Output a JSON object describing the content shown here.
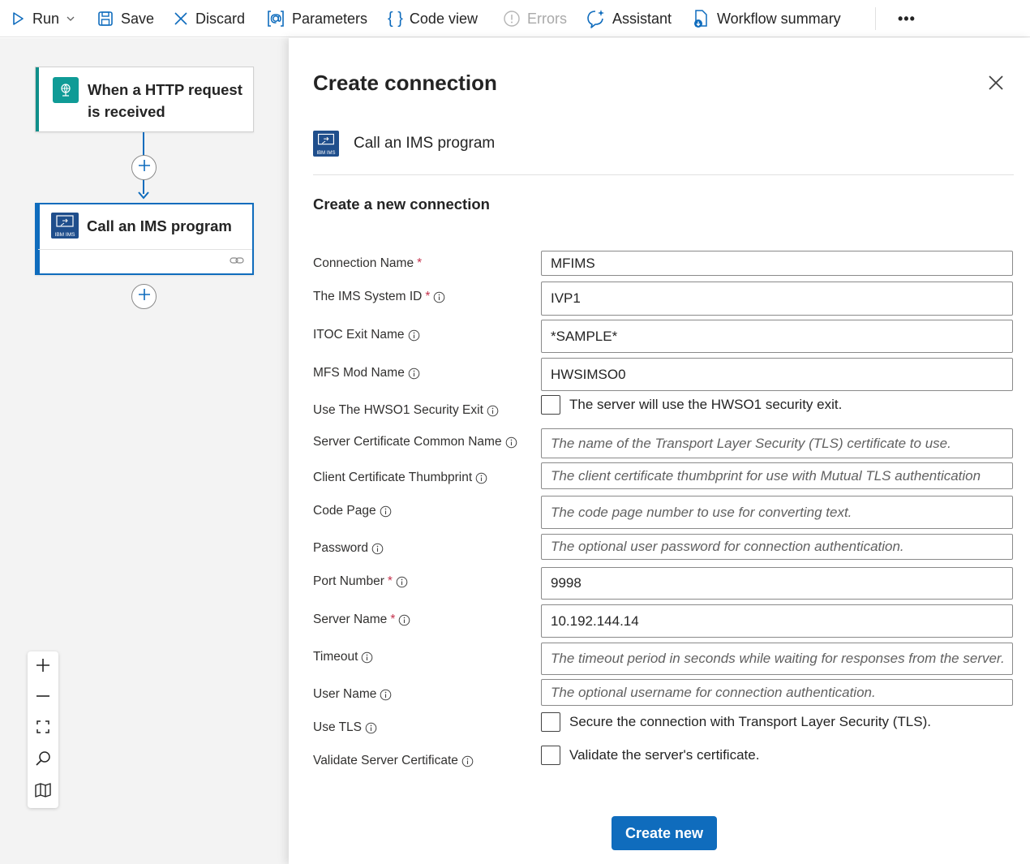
{
  "toolbar": {
    "run": "Run",
    "save": "Save",
    "discard": "Discard",
    "parameters": "Parameters",
    "code_view": "Code view",
    "errors": "Errors",
    "assistant": "Assistant",
    "workflow_summary": "Workflow summary",
    "more": "•••"
  },
  "canvas": {
    "trigger_title": "When a HTTP request is received",
    "action_title": "Call an IMS program",
    "action_icon_text": "IBM IMS"
  },
  "panel": {
    "title": "Create connection",
    "connector_name": "Call an IMS program",
    "connector_icon_text": "IBM IMS",
    "section_title": "Create a new connection",
    "fields": [
      {
        "label": "Connection Name",
        "required": "*",
        "value": "MFIMS",
        "placeholder": ""
      },
      {
        "label": "The IMS System ID",
        "required": "*",
        "value": "IVP1",
        "placeholder": ""
      },
      {
        "label": "ITOC Exit Name",
        "required": "",
        "value": "*SAMPLE*",
        "placeholder": ""
      },
      {
        "label": "MFS Mod Name",
        "required": "",
        "value": "HWSIMSO0",
        "placeholder": ""
      },
      {
        "label": "Use The HWSO1 Security Exit",
        "required": "",
        "checkbox_text": "The server will use the HWSO1 security exit."
      },
      {
        "label": "Server Certificate Common Name",
        "required": "",
        "value": "",
        "placeholder": "The name of the Transport Layer Security (TLS) certificate to use."
      },
      {
        "label": "Client Certificate Thumbprint",
        "required": "",
        "value": "",
        "placeholder": "The client certificate thumbprint for use with Mutual TLS authentication"
      },
      {
        "label": "Code Page",
        "required": "",
        "value": "",
        "placeholder": "The code page number to use for converting text."
      },
      {
        "label": "Password",
        "required": "",
        "value": "",
        "placeholder": "The optional user password for connection authentication."
      },
      {
        "label": "Port Number",
        "required": "*",
        "value": "9998",
        "placeholder": ""
      },
      {
        "label": "Server Name",
        "required": "*",
        "value": "10.192.144.14",
        "placeholder": ""
      },
      {
        "label": "Timeout",
        "required": "",
        "value": "",
        "placeholder": "The timeout period in seconds while waiting for responses from the server."
      },
      {
        "label": "User Name",
        "required": "",
        "value": "",
        "placeholder": "The optional username for connection authentication."
      },
      {
        "label": "Use TLS",
        "required": "",
        "checkbox_text": "Secure the connection with Transport Layer Security (TLS)."
      },
      {
        "label": "Validate Server Certificate",
        "required": "",
        "checkbox_text": "Validate the server's certificate."
      }
    ],
    "create_button": "Create new"
  },
  "colors": {
    "accent_blue": "#0f6cbd",
    "teal_trigger": "#0f8f8a",
    "ims_icon_bg": "#1f4e8c",
    "required_red": "#c4314b"
  }
}
